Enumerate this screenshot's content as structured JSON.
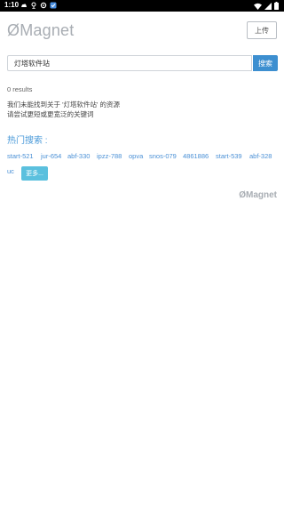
{
  "status_bar": {
    "time": "1:10"
  },
  "header": {
    "logo": "ØMagnet",
    "upload_label": "上传"
  },
  "search": {
    "value": "灯塔软件站",
    "button_label": "搜索"
  },
  "results": {
    "count_text": "0 results",
    "not_found_line1": "我们未能找到关于 '灯塔软件站' 的资源",
    "not_found_line2": "请尝试更短或更宽泛的关键词"
  },
  "hot": {
    "title": "热门搜索 :",
    "tags": [
      "start-521",
      "jur-654",
      "abf-330",
      "ipzz-788",
      "opva",
      "snos-079",
      "4861886",
      "start-539",
      "abf-328",
      "uc"
    ],
    "more_label": "更多..."
  },
  "footer": {
    "logo": "ØMagnet"
  }
}
